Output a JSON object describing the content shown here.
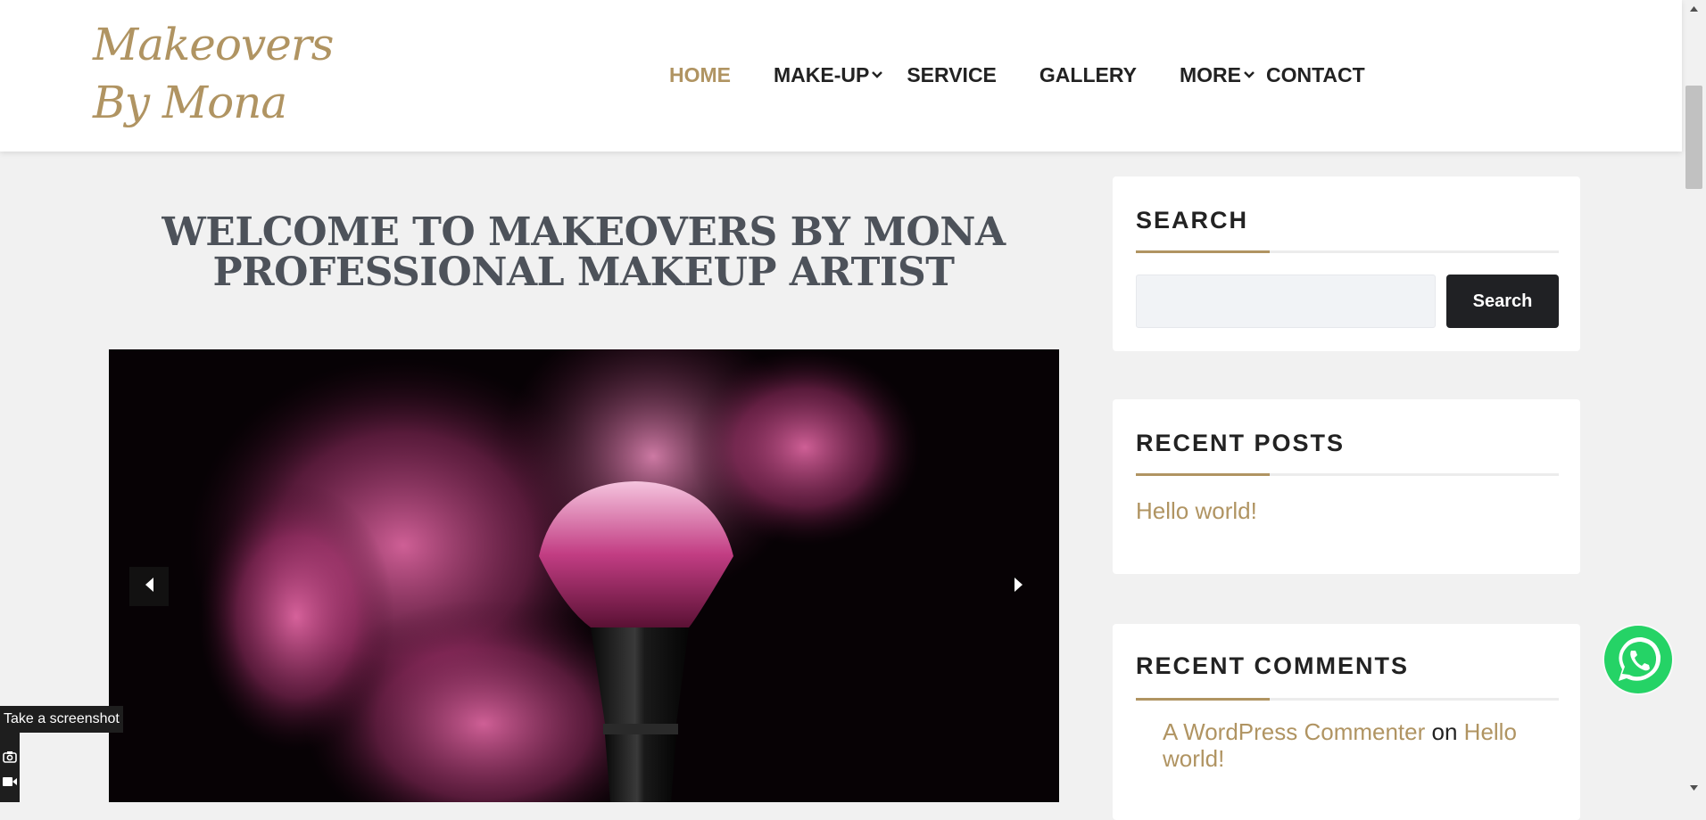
{
  "site": {
    "logo_text": "Makeovers By Mona"
  },
  "nav": {
    "items": [
      {
        "label": "HOME",
        "active": true
      },
      {
        "label": "MAKE-UP",
        "dropdown": true
      },
      {
        "label": "SERVICE"
      },
      {
        "label": "GALLERY"
      },
      {
        "label": "MORE",
        "dropdown": true
      },
      {
        "label": "CONTACT"
      }
    ]
  },
  "main": {
    "title_line1": "WELCOME TO MAKEOVERS BY MONA",
    "title_line2": "PROFESSIONAL MAKEUP ARTIST"
  },
  "sidebar": {
    "search": {
      "title": "SEARCH",
      "placeholder": "",
      "button_label": "Search"
    },
    "recent_posts": {
      "title": "RECENT POSTS",
      "items": [
        "Hello world!"
      ]
    },
    "recent_comments": {
      "title": "RECENT COMMENTS",
      "items": [
        {
          "author": "A WordPress Commenter",
          "connector": "on",
          "post": "Hello world!"
        }
      ]
    }
  },
  "overlay": {
    "tooltip": "Take a screenshot"
  },
  "icons": {
    "whatsapp": "whatsapp-icon",
    "slider_prev": "arrow-left-icon",
    "slider_next": "arrow-right-icon",
    "camera": "camera-icon",
    "video": "video-icon"
  },
  "colors": {
    "accent": "#b09462",
    "title": "#4d525a",
    "dark_button": "#202124",
    "whatsapp": "#25d366"
  }
}
